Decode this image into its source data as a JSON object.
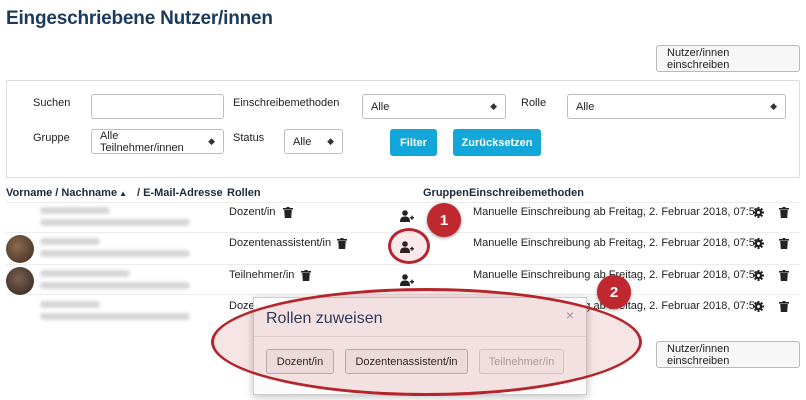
{
  "page": {
    "title": "Eingeschriebene Nutzer/innen"
  },
  "actions": {
    "enrol_button_label": "Nutzer/innen einschreiben"
  },
  "filters": {
    "search_label": "Suchen",
    "search_value": "",
    "method_label": "Einschreibemethoden",
    "method_value": "Alle",
    "role_label": "Rolle",
    "role_value": "Alle",
    "group_label": "Gruppe",
    "group_value": "Alle Teilnehmer/innen",
    "status_label": "Status",
    "status_value": "Alle",
    "filter_button": "Filter",
    "reset_button": "Zurücksetzen"
  },
  "table": {
    "headers": {
      "name": "Vorname / Nachname",
      "email": "/ E-Mail-Adresse",
      "roles": "Rollen",
      "groups": "Gruppen",
      "methods": "Einschreibemethoden"
    },
    "rows": [
      {
        "role": "Dozent/in",
        "method": "Manuelle Einschreibung ab Freitag, 2. Februar 2018, 07:51",
        "avatar": "none"
      },
      {
        "role": "Dozentenassistent/in",
        "method": "Manuelle Einschreibung ab Freitag, 2. Februar 2018, 07:51",
        "avatar": "photo"
      },
      {
        "role": "Teilnehmer/in",
        "method": "Manuelle Einschreibung ab Freitag, 2. Februar 2018, 07:51",
        "avatar": "photo"
      },
      {
        "role": "Doze",
        "method": "Manuelle Einschreibung ab Freitag, 2. Februar 2018, 07:51",
        "avatar": "none"
      }
    ]
  },
  "modal": {
    "title": "Rollen zuweisen",
    "close": "×",
    "options": [
      {
        "label": "Dozent/in",
        "enabled": true
      },
      {
        "label": "Dozentenassistent/in",
        "enabled": true
      },
      {
        "label": "Teilnehmer/in",
        "enabled": false
      }
    ]
  },
  "annotations": [
    {
      "number": "1"
    },
    {
      "number": "2"
    }
  ],
  "icons": {
    "trash": "trash-icon",
    "gear": "gear-icon",
    "assign_role": "user-plus-icon",
    "sort": "caret-up-icon"
  },
  "colors": {
    "title": "#1b3a5c",
    "primary_button": "#13a6d8",
    "annotation": "#c0282f"
  }
}
